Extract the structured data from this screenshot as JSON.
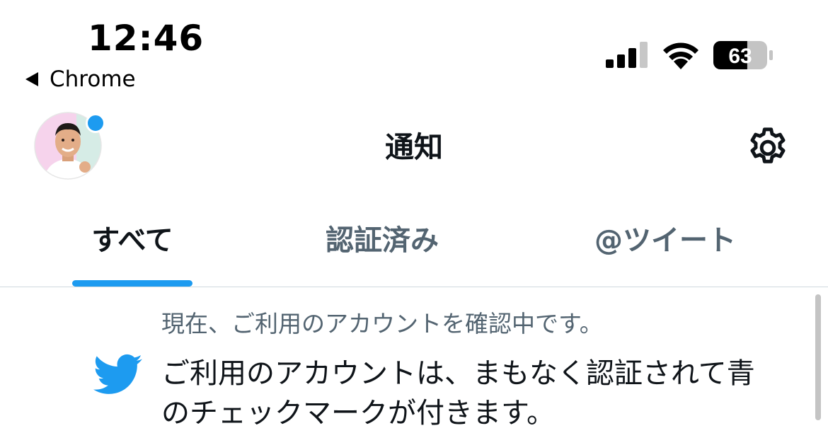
{
  "status_bar": {
    "time": "12:46",
    "back_app": "Chrome",
    "battery_level": "63",
    "signal_bars": 3,
    "signal_bars_total": 4
  },
  "header": {
    "title": "通知",
    "avatar_has_unread_dot": true,
    "accent_color": "#1d9bf0"
  },
  "tabs": [
    {
      "label": "すべて",
      "active": true
    },
    {
      "label": "認証済み",
      "active": false
    },
    {
      "label": "@ツイート",
      "active": false
    }
  ],
  "notification": {
    "icon": "twitter-bird-icon",
    "subtitle": "現在、ご利用のアカウントを確認中です。",
    "body_lines": [
      "ご利用のアカウントは、まもなく認証されて青",
      "のチェックマークが付きます。"
    ]
  }
}
